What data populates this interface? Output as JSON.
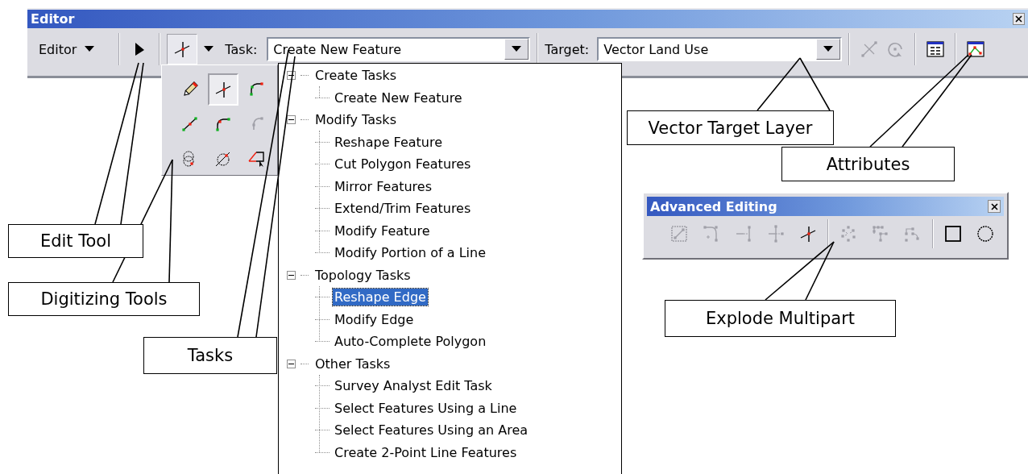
{
  "editor": {
    "title": "Editor",
    "menu": "Editor",
    "edit_tool": {
      "selected": false
    },
    "sketch_tool": {
      "selected": true
    },
    "task_label": "Task:",
    "task": "Create New Feature",
    "target_label": "Target:",
    "target": "Vector Land Use",
    "tool_groups": [
      [
        {
          "kind": "split",
          "disabled": true
        },
        {
          "kind": "rotate",
          "disabled": true
        }
      ],
      [
        {
          "kind": "attributes",
          "disabled": false
        }
      ],
      [
        {
          "kind": "properties",
          "disabled": false
        }
      ]
    ]
  },
  "digitizing_palette": {
    "tools": [
      {
        "kind": "pencil",
        "selected": false,
        "disabled": false
      },
      {
        "kind": "sketch",
        "selected": true,
        "disabled": false
      },
      {
        "kind": "arc",
        "selected": false,
        "disabled": false
      },
      {
        "kind": "midpoint",
        "selected": false,
        "disabled": false
      },
      {
        "kind": "endarc",
        "selected": false,
        "disabled": false
      },
      {
        "kind": "tangent",
        "selected": false,
        "disabled": true
      },
      {
        "kind": "intersection",
        "selected": false,
        "disabled": false
      },
      {
        "kind": "distance",
        "selected": false,
        "disabled": false
      },
      {
        "kind": "trace",
        "selected": false,
        "disabled": false
      }
    ]
  },
  "task_list": {
    "groups": [
      {
        "label": "Create Tasks",
        "expanded": true,
        "children": [
          {
            "label": "Create New Feature",
            "selected": false
          }
        ]
      },
      {
        "label": "Modify Tasks",
        "expanded": true,
        "children": [
          {
            "label": "Reshape Feature",
            "selected": false
          },
          {
            "label": "Cut Polygon Features",
            "selected": false
          },
          {
            "label": "Mirror Features",
            "selected": false
          },
          {
            "label": "Extend/Trim Features",
            "selected": false
          },
          {
            "label": "Modify Feature",
            "selected": false
          },
          {
            "label": "Modify Portion of a Line",
            "selected": false
          }
        ]
      },
      {
        "label": "Topology Tasks",
        "expanded": true,
        "children": [
          {
            "label": "Reshape Edge",
            "selected": true
          },
          {
            "label": "Modify Edge",
            "selected": false
          },
          {
            "label": "Auto-Complete Polygon",
            "selected": false
          }
        ]
      },
      {
        "label": "Other Tasks",
        "expanded": true,
        "children": [
          {
            "label": "Survey Analyst Edit Task",
            "selected": false
          },
          {
            "label": "Select Features Using a Line",
            "selected": false
          },
          {
            "label": "Select Features Using an Area",
            "selected": false
          },
          {
            "label": "Create 2-Point Line Features",
            "selected": false
          }
        ]
      }
    ]
  },
  "advanced_editing": {
    "title": "Advanced Editing",
    "tool_groups": [
      [
        {
          "kind": "copyparallel",
          "disabled": true
        },
        {
          "kind": "fillet",
          "disabled": true
        },
        {
          "kind": "extend",
          "disabled": true
        },
        {
          "kind": "trim",
          "disabled": true
        },
        {
          "kind": "sketch",
          "disabled": false
        }
      ],
      [
        {
          "kind": "explode",
          "disabled": true
        },
        {
          "kind": "generalize",
          "disabled": true
        },
        {
          "kind": "smooth",
          "disabled": true
        }
      ],
      [
        {
          "kind": "rectangle",
          "disabled": false
        },
        {
          "kind": "circle",
          "disabled": false
        }
      ]
    ]
  },
  "callouts": [
    {
      "label": "Edit Tool"
    },
    {
      "label": "Digitizing Tools"
    },
    {
      "label": "Tasks"
    },
    {
      "label": "Vector Target Layer"
    },
    {
      "label": "Attributes"
    },
    {
      "label": "Explode Multipart"
    }
  ]
}
